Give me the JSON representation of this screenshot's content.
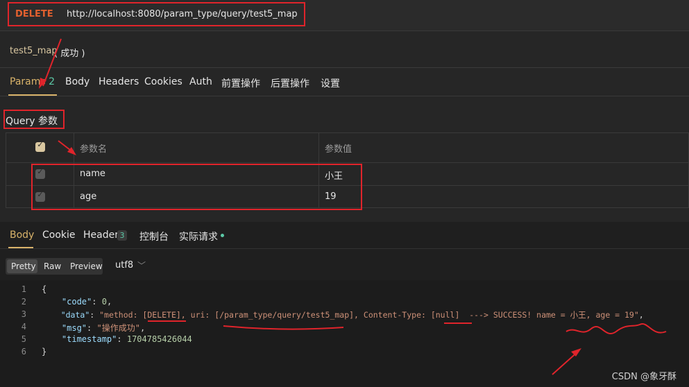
{
  "request": {
    "method": "DELETE",
    "url": "http://localhost:8080/param_type/query/test5_map",
    "name": "test5_map",
    "status": "( 成功 )"
  },
  "tabs": [
    "Params",
    "Body",
    "Headers",
    "Cookies",
    "Auth",
    "前置操作",
    "后置操作",
    "设置"
  ],
  "params_badge": "2",
  "query_section": "Query 参数",
  "table": {
    "headers": [
      "参数名",
      "参数值"
    ],
    "rows": [
      {
        "name": "name",
        "value": "小王"
      },
      {
        "name": "age",
        "value": "19"
      }
    ]
  },
  "response": {
    "tabs": [
      "Body",
      "Cookie",
      "Header",
      "控制台",
      "实际请求"
    ],
    "header_badge": "3",
    "formats": [
      "Pretty",
      "Raw",
      "Preview"
    ],
    "encoding": "utf8",
    "line_numbers": [
      "1",
      "2",
      "3",
      "4",
      "5",
      "6"
    ],
    "json": {
      "open": "{",
      "code_key": "\"code\"",
      "code_val": "0",
      "data_key": "\"data\"",
      "data_val": "\"method: [DELETE], uri: [/param_type/query/test5_map], Content-Type: [null]  ---> SUCCESS! name = 小王, age = 19\"",
      "msg_key": "\"msg\"",
      "msg_val": "\"操作成功\"",
      "ts_key": "\"timestamp\"",
      "ts_val": "1704785426044",
      "close": "}"
    }
  },
  "watermark": "CSDN @象牙酥",
  "colors": {
    "method": "#e2602f",
    "accent": "#d9b36a",
    "annotation": "#e0242b"
  }
}
